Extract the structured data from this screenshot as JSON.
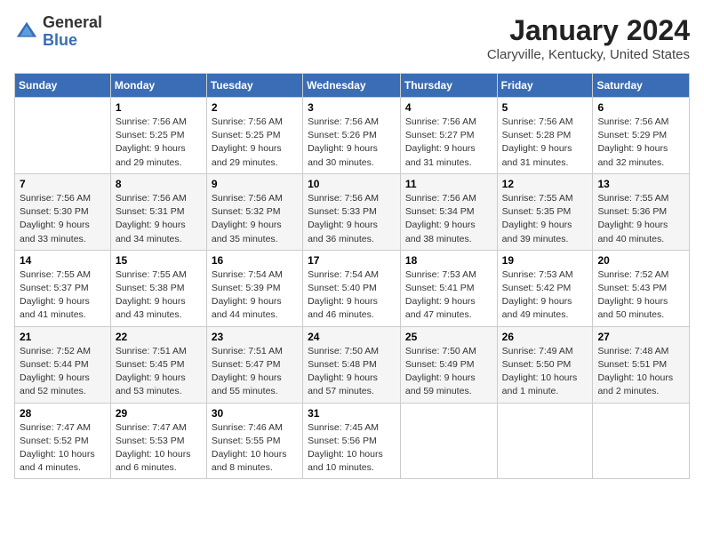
{
  "header": {
    "logo_general": "General",
    "logo_blue": "Blue",
    "month_title": "January 2024",
    "location": "Claryville, Kentucky, United States"
  },
  "days_of_week": [
    "Sunday",
    "Monday",
    "Tuesday",
    "Wednesday",
    "Thursday",
    "Friday",
    "Saturday"
  ],
  "weeks": [
    [
      {
        "day": "",
        "info": ""
      },
      {
        "day": "1",
        "info": "Sunrise: 7:56 AM\nSunset: 5:25 PM\nDaylight: 9 hours\nand 29 minutes."
      },
      {
        "day": "2",
        "info": "Sunrise: 7:56 AM\nSunset: 5:25 PM\nDaylight: 9 hours\nand 29 minutes."
      },
      {
        "day": "3",
        "info": "Sunrise: 7:56 AM\nSunset: 5:26 PM\nDaylight: 9 hours\nand 30 minutes."
      },
      {
        "day": "4",
        "info": "Sunrise: 7:56 AM\nSunset: 5:27 PM\nDaylight: 9 hours\nand 31 minutes."
      },
      {
        "day": "5",
        "info": "Sunrise: 7:56 AM\nSunset: 5:28 PM\nDaylight: 9 hours\nand 31 minutes."
      },
      {
        "day": "6",
        "info": "Sunrise: 7:56 AM\nSunset: 5:29 PM\nDaylight: 9 hours\nand 32 minutes."
      }
    ],
    [
      {
        "day": "7",
        "info": "Sunrise: 7:56 AM\nSunset: 5:30 PM\nDaylight: 9 hours\nand 33 minutes."
      },
      {
        "day": "8",
        "info": "Sunrise: 7:56 AM\nSunset: 5:31 PM\nDaylight: 9 hours\nand 34 minutes."
      },
      {
        "day": "9",
        "info": "Sunrise: 7:56 AM\nSunset: 5:32 PM\nDaylight: 9 hours\nand 35 minutes."
      },
      {
        "day": "10",
        "info": "Sunrise: 7:56 AM\nSunset: 5:33 PM\nDaylight: 9 hours\nand 36 minutes."
      },
      {
        "day": "11",
        "info": "Sunrise: 7:56 AM\nSunset: 5:34 PM\nDaylight: 9 hours\nand 38 minutes."
      },
      {
        "day": "12",
        "info": "Sunrise: 7:55 AM\nSunset: 5:35 PM\nDaylight: 9 hours\nand 39 minutes."
      },
      {
        "day": "13",
        "info": "Sunrise: 7:55 AM\nSunset: 5:36 PM\nDaylight: 9 hours\nand 40 minutes."
      }
    ],
    [
      {
        "day": "14",
        "info": "Sunrise: 7:55 AM\nSunset: 5:37 PM\nDaylight: 9 hours\nand 41 minutes."
      },
      {
        "day": "15",
        "info": "Sunrise: 7:55 AM\nSunset: 5:38 PM\nDaylight: 9 hours\nand 43 minutes."
      },
      {
        "day": "16",
        "info": "Sunrise: 7:54 AM\nSunset: 5:39 PM\nDaylight: 9 hours\nand 44 minutes."
      },
      {
        "day": "17",
        "info": "Sunrise: 7:54 AM\nSunset: 5:40 PM\nDaylight: 9 hours\nand 46 minutes."
      },
      {
        "day": "18",
        "info": "Sunrise: 7:53 AM\nSunset: 5:41 PM\nDaylight: 9 hours\nand 47 minutes."
      },
      {
        "day": "19",
        "info": "Sunrise: 7:53 AM\nSunset: 5:42 PM\nDaylight: 9 hours\nand 49 minutes."
      },
      {
        "day": "20",
        "info": "Sunrise: 7:52 AM\nSunset: 5:43 PM\nDaylight: 9 hours\nand 50 minutes."
      }
    ],
    [
      {
        "day": "21",
        "info": "Sunrise: 7:52 AM\nSunset: 5:44 PM\nDaylight: 9 hours\nand 52 minutes."
      },
      {
        "day": "22",
        "info": "Sunrise: 7:51 AM\nSunset: 5:45 PM\nDaylight: 9 hours\nand 53 minutes."
      },
      {
        "day": "23",
        "info": "Sunrise: 7:51 AM\nSunset: 5:47 PM\nDaylight: 9 hours\nand 55 minutes."
      },
      {
        "day": "24",
        "info": "Sunrise: 7:50 AM\nSunset: 5:48 PM\nDaylight: 9 hours\nand 57 minutes."
      },
      {
        "day": "25",
        "info": "Sunrise: 7:50 AM\nSunset: 5:49 PM\nDaylight: 9 hours\nand 59 minutes."
      },
      {
        "day": "26",
        "info": "Sunrise: 7:49 AM\nSunset: 5:50 PM\nDaylight: 10 hours\nand 1 minute."
      },
      {
        "day": "27",
        "info": "Sunrise: 7:48 AM\nSunset: 5:51 PM\nDaylight: 10 hours\nand 2 minutes."
      }
    ],
    [
      {
        "day": "28",
        "info": "Sunrise: 7:47 AM\nSunset: 5:52 PM\nDaylight: 10 hours\nand 4 minutes."
      },
      {
        "day": "29",
        "info": "Sunrise: 7:47 AM\nSunset: 5:53 PM\nDaylight: 10 hours\nand 6 minutes."
      },
      {
        "day": "30",
        "info": "Sunrise: 7:46 AM\nSunset: 5:55 PM\nDaylight: 10 hours\nand 8 minutes."
      },
      {
        "day": "31",
        "info": "Sunrise: 7:45 AM\nSunset: 5:56 PM\nDaylight: 10 hours\nand 10 minutes."
      },
      {
        "day": "",
        "info": ""
      },
      {
        "day": "",
        "info": ""
      },
      {
        "day": "",
        "info": ""
      }
    ]
  ]
}
